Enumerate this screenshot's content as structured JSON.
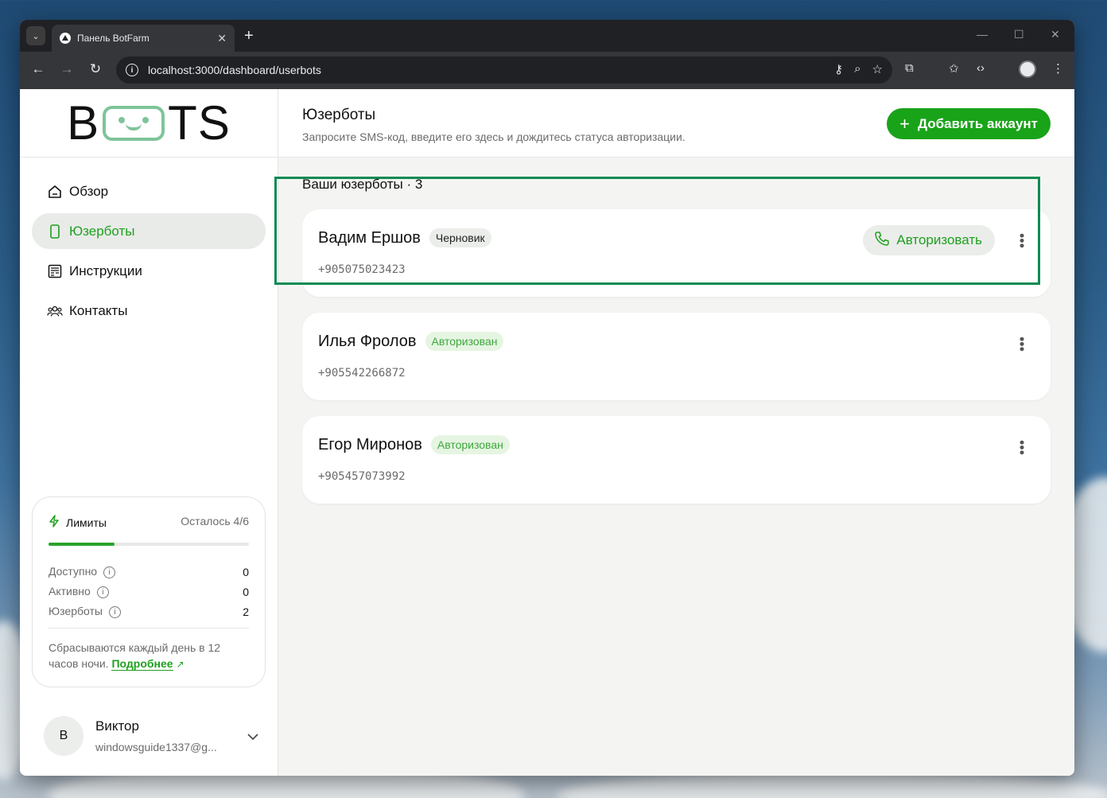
{
  "browser": {
    "tab_title": "Панель BotFarm",
    "url": "localhost:3000/dashboard/userbots"
  },
  "sidebar": {
    "logo_left": "B",
    "logo_right": "TS",
    "nav": [
      {
        "label": "Обзор",
        "icon": "home-icon",
        "active": false
      },
      {
        "label": "Юзерботы",
        "icon": "phone-icon",
        "active": true
      },
      {
        "label": "Инструкции",
        "icon": "document-icon",
        "active": false
      },
      {
        "label": "Контакты",
        "icon": "people-icon",
        "active": false
      }
    ],
    "limits": {
      "title": "Лимиты",
      "remaining": "Осталось 4/6",
      "progress_fraction": 0.33,
      "rows": [
        {
          "label": "Доступно",
          "value": "0"
        },
        {
          "label": "Активно",
          "value": "0"
        },
        {
          "label": "Юзерботы",
          "value": "2"
        }
      ],
      "note": "Сбрасываются каждый день в 12 часов ночи.",
      "link": "Подробнее"
    },
    "user": {
      "initial": "В",
      "name": "Виктор",
      "email": "windowsguide1337@g..."
    }
  },
  "main": {
    "title": "Юзерботы",
    "subtitle": "Запросите SMS-код, введите его здесь и дождитесь статуса авторизации.",
    "add_button": "Добавить аккаунт",
    "section_title": "Ваши юзерботы · 3",
    "cards": [
      {
        "name": "Вадим Ершов",
        "badge": "Черновик",
        "phone": "+905075023423",
        "action": "Авторизовать"
      },
      {
        "name": "Илья Фролов",
        "badge": "Авторизован",
        "phone": "+905542266872"
      },
      {
        "name": "Егор Миронов",
        "badge": "Авторизован",
        "phone": "+905457073992"
      }
    ]
  },
  "colors": {
    "accent": "#19a319",
    "focus_frame": "#0d8a52"
  }
}
